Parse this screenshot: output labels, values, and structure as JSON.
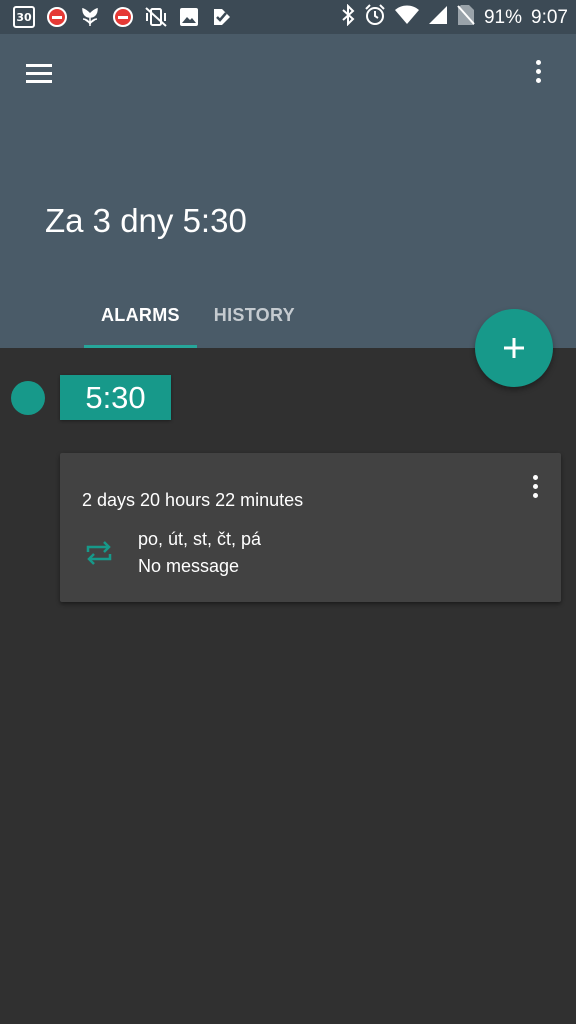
{
  "status_bar": {
    "battery": "91%",
    "time": "9:07",
    "calendar_day": "30",
    "left_icons": [
      "calendar-icon",
      "stop-sign-icon",
      "tulip-icon",
      "stop-sign-icon",
      "vibrate-off-icon",
      "image-icon",
      "check-icon"
    ],
    "right_icons": [
      "bluetooth-icon",
      "alarm-clock-icon",
      "wifi-icon",
      "signal-icon",
      "no-sim-icon"
    ]
  },
  "app_bar": {
    "next_alarm_title": "Za 3 dny 5:30",
    "menu_icon": "hamburger-menu-icon",
    "overflow_icon": "more-vert-icon"
  },
  "tabs": [
    {
      "label": "ALARMS",
      "active": true
    },
    {
      "label": "HISTORY",
      "active": false
    }
  ],
  "fab": {
    "icon": "plus-icon"
  },
  "alarm": {
    "time": "5:30",
    "enabled": true,
    "countdown": "2 days 20 hours 22 minutes",
    "repeat_days": "po, út, st, čt, pá",
    "message": "No message"
  },
  "colors": {
    "accent": "#17998a",
    "app_bar": "#4a5b68",
    "status_bar": "#3c4a55",
    "background": "#303030",
    "card": "#424242"
  }
}
